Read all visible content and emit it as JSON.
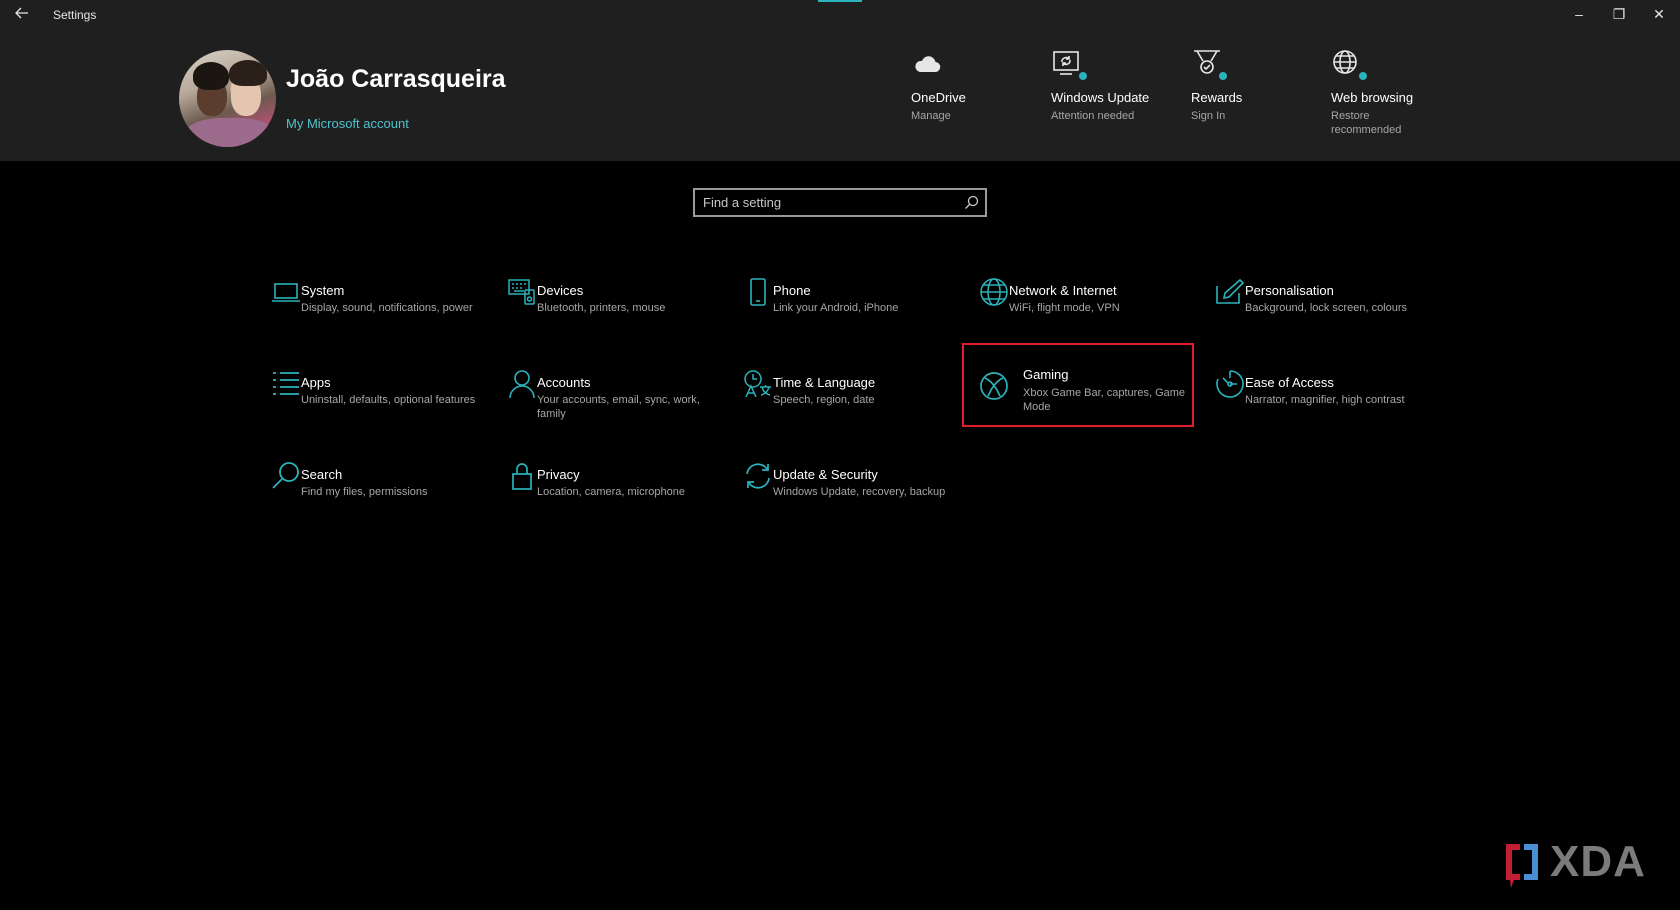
{
  "window": {
    "title": "Settings",
    "back_icon": "back-arrow-icon",
    "controls": {
      "minimize": "–",
      "maximize": "❐",
      "close": "✕"
    }
  },
  "header": {
    "user_name": "João Carrasqueira",
    "account_link": "My Microsoft account",
    "quick_links": [
      {
        "icon": "cloud-icon",
        "title": "OneDrive",
        "subtitle": "Manage"
      },
      {
        "icon": "windows-update-icon",
        "title": "Windows Update",
        "subtitle": "Attention needed"
      },
      {
        "icon": "rewards-trophy-icon",
        "title": "Rewards",
        "subtitle": "Sign In"
      },
      {
        "icon": "globe-icon",
        "title": "Web browsing",
        "subtitle": "Restore recommended"
      }
    ]
  },
  "search": {
    "placeholder": "Find a setting",
    "icon": "search-icon"
  },
  "categories": [
    {
      "icon": "laptop-icon",
      "title": "System",
      "description": "Display, sound, notifications, power"
    },
    {
      "icon": "keyboard-icon",
      "title": "Devices",
      "description": "Bluetooth, printers, mouse"
    },
    {
      "icon": "phone-icon",
      "title": "Phone",
      "description": "Link your Android, iPhone"
    },
    {
      "icon": "globe-icon",
      "title": "Network & Internet",
      "description": "WiFi, flight mode, VPN"
    },
    {
      "icon": "paintbrush-icon",
      "title": "Personalisation",
      "description": "Background, lock screen, colours"
    },
    {
      "icon": "list-icon",
      "title": "Apps",
      "description": "Uninstall, defaults, optional features"
    },
    {
      "icon": "person-icon",
      "title": "Accounts",
      "description": "Your accounts, email, sync, work, family"
    },
    {
      "icon": "language-icon",
      "title": "Time & Language",
      "description": "Speech, region, date"
    },
    {
      "icon": "xbox-icon",
      "title": "Gaming",
      "description": "Xbox Game Bar, captures, Game Mode",
      "highlighted": true
    },
    {
      "icon": "ease-of-access-icon",
      "title": "Ease of Access",
      "description": "Narrator, magnifier, high contrast"
    },
    {
      "icon": "search-icon",
      "title": "Search",
      "description": "Find my files, permissions"
    },
    {
      "icon": "lock-icon",
      "title": "Privacy",
      "description": "Location, camera, microphone"
    },
    {
      "icon": "sync-icon",
      "title": "Update & Security",
      "description": "Windows Update, recovery, backup"
    }
  ],
  "watermark": {
    "text": "XDA"
  },
  "colors": {
    "accent": "#2bb3bb",
    "link": "#4ec3cc",
    "highlight_border": "#e21c2b",
    "header_bg": "#1f1f1f",
    "page_bg": "#000000"
  }
}
